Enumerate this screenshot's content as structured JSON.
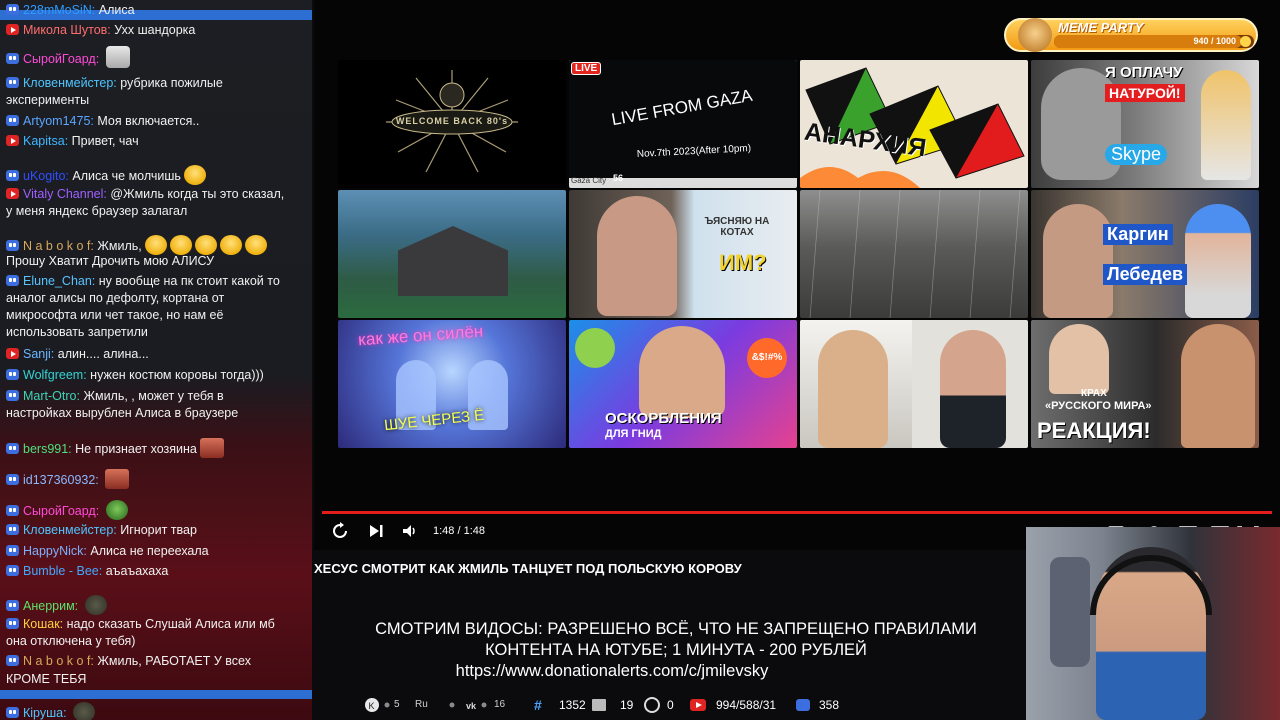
{
  "chat": {
    "messages": [
      {
        "platform": "twitch",
        "nick": "228mMoSiN:",
        "nick_color": "#2e9bff",
        "text": "Алиса"
      },
      {
        "platform": "youtube",
        "nick": "Микола Шутов:",
        "nick_color": "#ff6d6d",
        "text": "Ухх шандорка"
      },
      {
        "platform": "twitch",
        "nick": "СыройГоард:",
        "nick_color": "#ff4bd8",
        "text": ""
      },
      {
        "platform": "twitch",
        "nick": "Кловенмейстер:",
        "nick_color": "#4ec5ff",
        "text": "рубрика пожилые"
      },
      {
        "platform": "none",
        "nick": "",
        "nick_color": "#fff",
        "text": "эксперименты"
      },
      {
        "platform": "twitch",
        "nick": "Artyom1475:",
        "nick_color": "#5aa6ff",
        "text": "Моя включается.."
      },
      {
        "platform": "youtube",
        "nick": "Kapitsa:",
        "nick_color": "#3fb6ff",
        "text": "Привет, чач"
      },
      {
        "platform": "twitch",
        "nick": "uKogito:",
        "nick_color": "#2f4fff",
        "text": "Алиса че молчишь"
      },
      {
        "platform": "youtube",
        "nick": "Vitaly Channel:",
        "nick_color": "#a060ff",
        "text": "@Жмиль когда ты это сказал,"
      },
      {
        "platform": "none",
        "nick": "",
        "nick_color": "#fff",
        "text": "у меня яндекс браузер залагал"
      },
      {
        "platform": "twitch",
        "nick": "N a b o k o f:",
        "nick_color": "#d7a95a",
        "text": "Жмиль,"
      },
      {
        "platform": "none",
        "nick": "",
        "nick_color": "#fff",
        "text": "Прошу Хватит Дрочить мою АЛИСУ"
      },
      {
        "platform": "twitch",
        "nick": "Elune_Chan:",
        "nick_color": "#58c3ff",
        "text": "ну вообще на пк стоит какой то"
      },
      {
        "platform": "none",
        "nick": "",
        "nick_color": "#fff",
        "text": "аналог алисы по дефолту, кортана от"
      },
      {
        "platform": "none",
        "nick": "",
        "nick_color": "#fff",
        "text": "микрософта или чет такое, но нам её"
      },
      {
        "platform": "none",
        "nick": "",
        "nick_color": "#fff",
        "text": "использовать запретили"
      },
      {
        "platform": "youtube",
        "nick": "Sanji:",
        "nick_color": "#6ab7ff",
        "text": "алин.... алина..."
      },
      {
        "platform": "twitch",
        "nick": "Wolfgreem:",
        "nick_color": "#34d3d3",
        "text": "нужен костюм коровы тогда)))"
      },
      {
        "platform": "twitch",
        "nick": "Mart-Otro:",
        "nick_color": "#3fd3b6",
        "text": "Жмиль, , может у тебя в"
      },
      {
        "platform": "none",
        "nick": "",
        "nick_color": "#fff",
        "text": "настройках вырублен Алиса в браузере"
      },
      {
        "platform": "twitch",
        "nick": "bers991:",
        "nick_color": "#4fe07c",
        "text": "Не признает хозяина"
      },
      {
        "platform": "twitch",
        "nick": "id137360932:",
        "nick_color": "#8ab8ff",
        "text": ""
      },
      {
        "platform": "twitch",
        "nick": "СыройГоард:",
        "nick_color": "#ff4bd8",
        "text": ""
      },
      {
        "platform": "twitch",
        "nick": "Кловенмейстер:",
        "nick_color": "#4ec5ff",
        "text": "Игнорит твар"
      },
      {
        "platform": "twitch",
        "nick": "HappyNick:",
        "nick_color": "#7fb0ff",
        "text": "Алиса не переехала"
      },
      {
        "platform": "twitch",
        "nick": "Bumble - Bee:",
        "nick_color": "#44a8ff",
        "text": "аъаъахаха"
      },
      {
        "platform": "twitch",
        "nick": "Анеррим:",
        "nick_color": "#5de06c",
        "text": ""
      },
      {
        "platform": "twitch",
        "nick": "Кошак:",
        "nick_color": "#ffd23f",
        "text": "надо сказать Слушай Алиса или мб"
      },
      {
        "platform": "none",
        "nick": "",
        "nick_color": "#fff",
        "text": "она отключена у тебя)"
      },
      {
        "platform": "twitch",
        "nick": "N a b o k o f:",
        "nick_color": "#d7a95a",
        "text": "Жмиль, РАБОТАЕТ У всех"
      },
      {
        "platform": "none",
        "nick": "",
        "nick_color": "#fff",
        "text": "КРОМЕ ТЕБЯ"
      },
      {
        "platform": "twitch",
        "nick": "Кiруша:",
        "nick_color": "#4ec5ff",
        "text": ""
      }
    ]
  },
  "meme_party": {
    "title": "MEME PARTY",
    "count": "940 / 1000",
    "fraction": 0.94
  },
  "thumbnails": [
    {
      "id": "t1",
      "text": "WELCOME BACK 80's"
    },
    {
      "id": "t2",
      "live": "LIVE",
      "text": "LIVE FROM GAZA",
      "sub": "Nov.7th 2023(After 10pm)",
      "corner": "Gaza City",
      "num": "56"
    },
    {
      "id": "t3",
      "text": "АНАРХИЯ"
    },
    {
      "id": "t4",
      "text": "Я ОПЛАЧУ",
      "text2": "НАТУРОЙ!",
      "text3": "Skype"
    },
    {
      "id": "t5",
      "text": ""
    },
    {
      "id": "t6",
      "text": "ЪЯСНЯЮ НА КОТАХ",
      "text2": "ИМ?"
    },
    {
      "id": "t7",
      "text": ""
    },
    {
      "id": "t8",
      "text": "Каргин",
      "text2": "Лебедев"
    },
    {
      "id": "t9",
      "text": "как же он силён",
      "text2": "ШУЕ ЧЕРЕЗ Ё"
    },
    {
      "id": "t10",
      "text": "ОСКОРБЛЕНИЯ",
      "text2": "ДЛЯ ГНИД",
      "emoji": "&$!#%"
    },
    {
      "id": "t11",
      "text": ""
    },
    {
      "id": "t12",
      "text": "КРАХ",
      "text2": "«РУССКОГО МИРА»",
      "text3": "РЕАКЦИЯ!"
    }
  ],
  "player": {
    "time": "1:48 / 1:48",
    "progress": 1.0
  },
  "video_title": "ХЕСУС СМОТРИТ КАК ЖМИЛЬ ТАНЦУЕТ ПОД ПОЛЬСКУЮ КОРОВУ",
  "overlay": {
    "line1": "СМОТРИМ ВИДОСЫ: РАЗРЕШЕНО ВСЁ, ЧТО НЕ ЗАПРЕЩЕНО ПРАВИЛАМИ",
    "line2": "КОНТЕНТА НА  ЮТУБЕ; 1 МИНУТА - 200 РУБЛЕЙ",
    "line3": "https://www.donationalerts.com/c/jmilevsky"
  },
  "stats": {
    "k_count": "5",
    "ru_label": "Ru",
    "vk_count": "16",
    "hash_count": "1352",
    "g_left": "19",
    "g_right": "0",
    "yt_count": "994/588/31",
    "tw_count": "358"
  },
  "colors": {
    "accent_blue": "#2d6ed3",
    "progress_red": "#e51c1c",
    "meme_orange": "#f29a12"
  }
}
